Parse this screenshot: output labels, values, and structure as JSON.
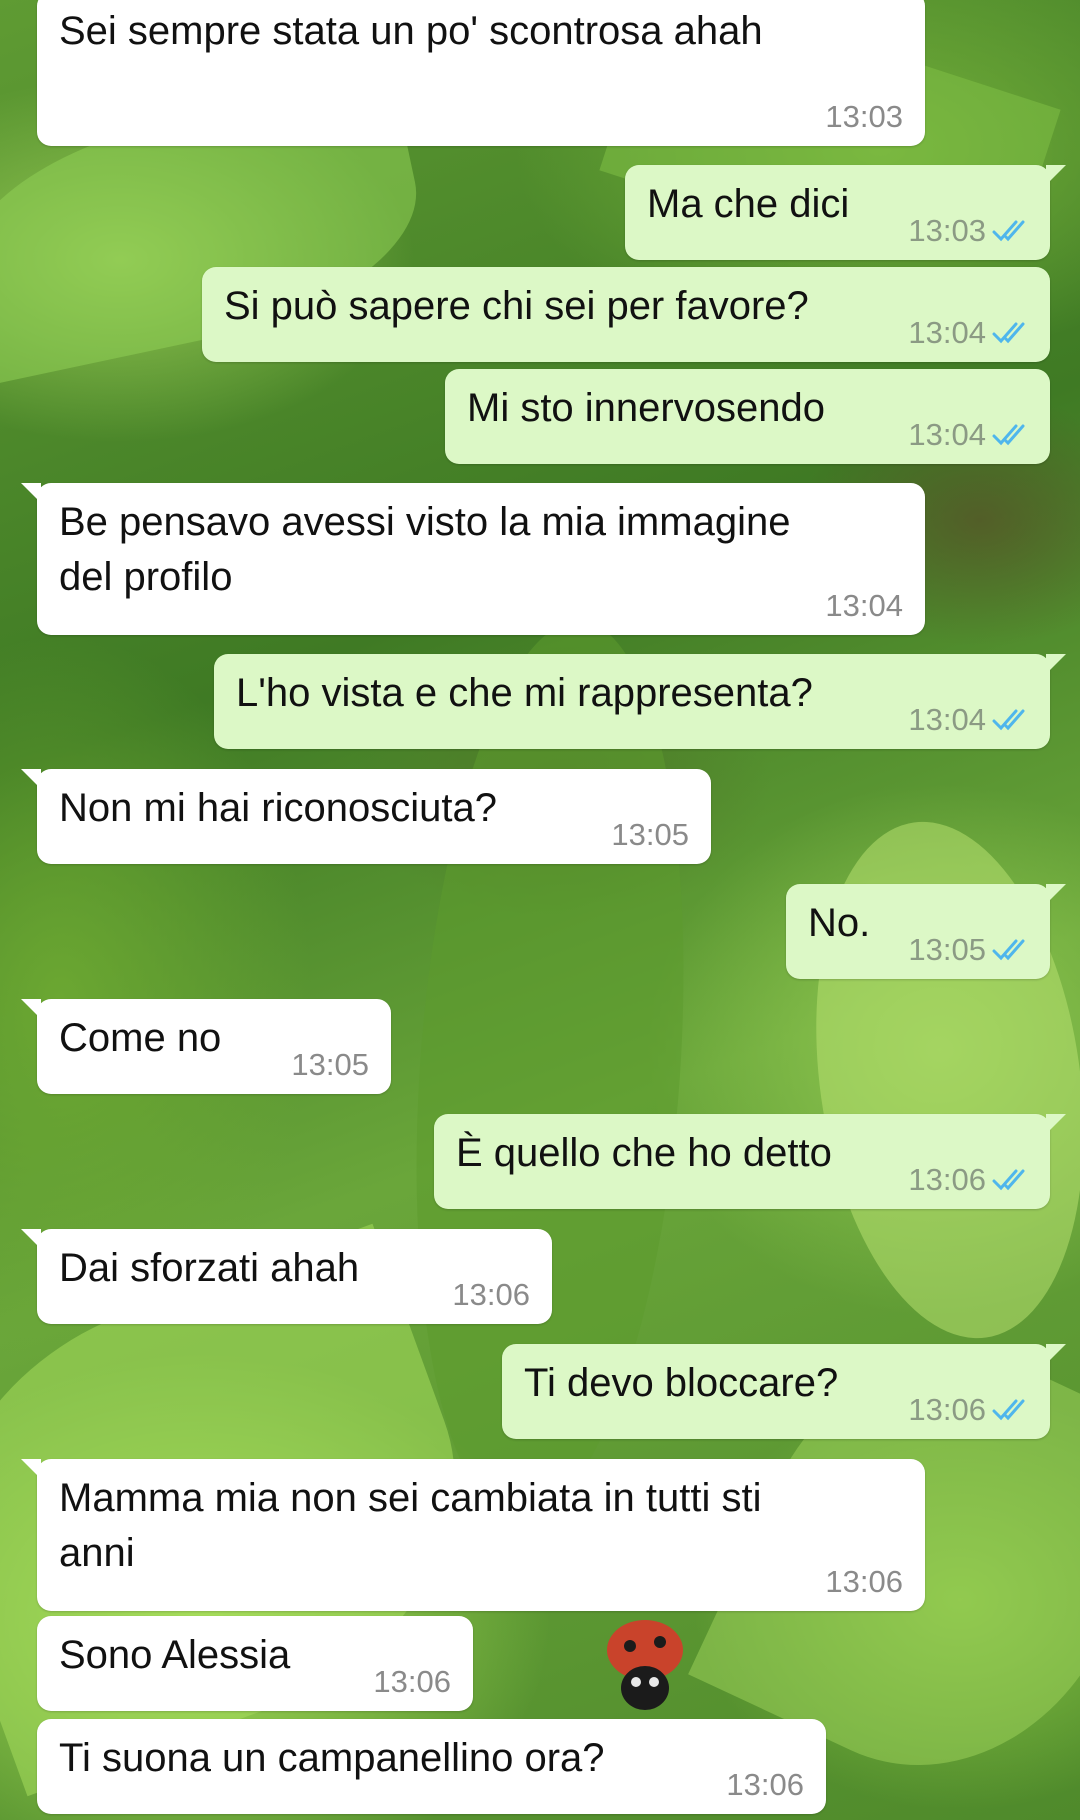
{
  "colors": {
    "incoming_bubble": "#ffffff",
    "outgoing_bubble": "#dcf8c6",
    "timestamp": "#8a8a8a",
    "read_ticks": "#4fb6ec"
  },
  "messages": [
    {
      "direction": "in",
      "text": "Sei sempre stata un po' scontrosa ahah",
      "time": "13:03"
    },
    {
      "direction": "out",
      "text": "Ma che dici",
      "time": "13:03",
      "status": "read"
    },
    {
      "direction": "out",
      "text": "Si può sapere chi sei per favore?",
      "time": "13:04",
      "status": "read"
    },
    {
      "direction": "out",
      "text": "Mi sto innervosendo",
      "time": "13:04",
      "status": "read"
    },
    {
      "direction": "in",
      "text": "Be pensavo avessi visto la mia immagine\ndel profilo",
      "time": "13:04"
    },
    {
      "direction": "out",
      "text": "L'ho vista e che mi rappresenta?",
      "time": "13:04",
      "status": "read"
    },
    {
      "direction": "in",
      "text": "Non mi hai riconosciuta?",
      "time": "13:05"
    },
    {
      "direction": "out",
      "text": "No.",
      "time": "13:05",
      "status": "read"
    },
    {
      "direction": "in",
      "text": "Come no",
      "time": "13:05"
    },
    {
      "direction": "out",
      "text": "È quello che ho detto",
      "time": "13:06",
      "status": "read"
    },
    {
      "direction": "in",
      "text": "Dai sforzati ahah",
      "time": "13:06"
    },
    {
      "direction": "out",
      "text": "Ti devo bloccare?",
      "time": "13:06",
      "status": "read"
    },
    {
      "direction": "in",
      "text": "Mamma mia non sei cambiata in tutti sti\nanni",
      "time": "13:06"
    },
    {
      "direction": "in",
      "text": "Sono Alessia",
      "time": "13:06"
    },
    {
      "direction": "in",
      "text": "Ti suona un campanellino ora?",
      "time": "13:06"
    }
  ]
}
